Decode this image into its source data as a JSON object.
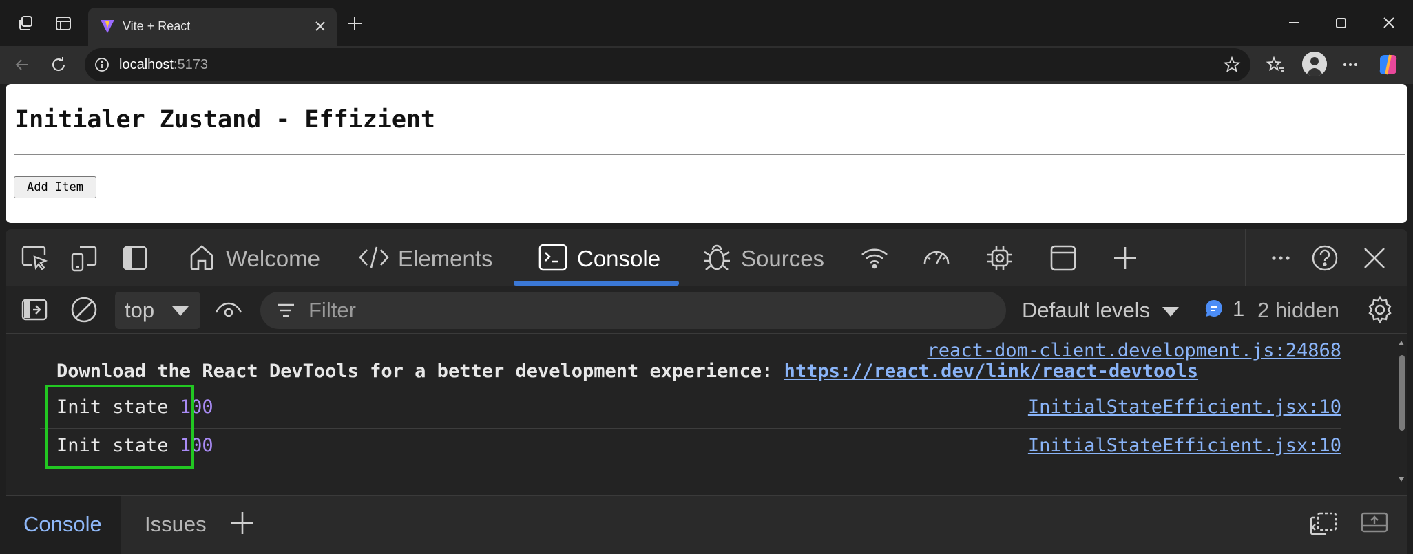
{
  "browser": {
    "tab_title": "Vite + React",
    "address_host": "localhost",
    "address_port": ":5173"
  },
  "page": {
    "heading": "Initialer Zustand - Effizient",
    "add_button_label": "Add Item"
  },
  "devtools": {
    "tabs": [
      {
        "label": "Welcome",
        "icon": "home-icon"
      },
      {
        "label": "Elements",
        "icon": "code-icon"
      },
      {
        "label": "Console",
        "icon": "console-icon",
        "active": true
      },
      {
        "label": "Sources",
        "icon": "bug-icon"
      }
    ],
    "toolbar": {
      "context": "top",
      "filter_placeholder": "Filter",
      "levels": "Default levels",
      "message_count": "1",
      "hidden": "2 hidden"
    },
    "console_lines": [
      {
        "source": "react-dom-client.development.js:24868",
        "text": "Download the React DevTools for a better development experience: ",
        "link": "https://react.dev/link/react-devtools"
      },
      {
        "text": "Init state ",
        "value": "100",
        "source": "InitialStateEfficient.jsx:10"
      },
      {
        "text": "Init state ",
        "value": "100",
        "source": "InitialStateEfficient.jsx:10"
      }
    ],
    "drawer_tabs": [
      "Console",
      "Issues"
    ]
  },
  "colors": {
    "highlight_box": "#22c722",
    "active_tab_underline": "#3b78d6",
    "link": "#8ab4f8",
    "number": "#a98bf5"
  }
}
